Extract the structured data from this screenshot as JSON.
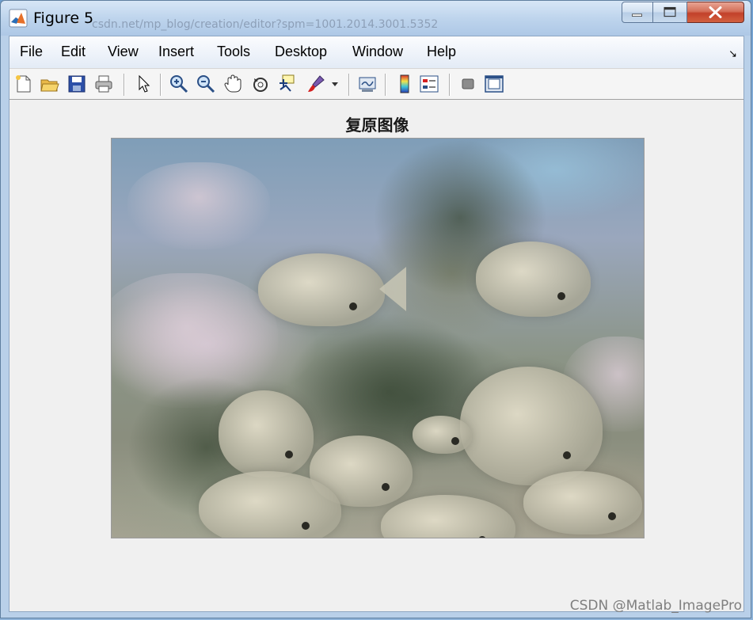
{
  "window": {
    "title": "Figure 5",
    "background_url_fragment": "csdn.net/mp_blog/creation/editor?spm=1001.2014.3001.5352"
  },
  "menu": {
    "items": [
      {
        "label": "File"
      },
      {
        "label": "Edit"
      },
      {
        "label": "View"
      },
      {
        "label": "Insert"
      },
      {
        "label": "Tools"
      },
      {
        "label": "Desktop"
      },
      {
        "label": "Window"
      },
      {
        "label": "Help"
      }
    ],
    "dock_glyph": "↘"
  },
  "toolbar": {
    "buttons": [
      {
        "icon": "new-figure-icon"
      },
      {
        "icon": "open-file-icon"
      },
      {
        "icon": "save-icon"
      },
      {
        "icon": "print-icon"
      },
      {
        "icon": "edit-plot-arrow-icon"
      },
      {
        "icon": "zoom-in-icon"
      },
      {
        "icon": "zoom-out-icon"
      },
      {
        "icon": "pan-hand-icon"
      },
      {
        "icon": "rotate-3d-icon"
      },
      {
        "icon": "data-cursor-icon"
      },
      {
        "icon": "brush-icon"
      },
      {
        "icon": "link-plot-icon"
      },
      {
        "icon": "colorbar-icon"
      },
      {
        "icon": "legend-icon"
      },
      {
        "icon": "hide-plot-tools-icon"
      },
      {
        "icon": "show-plot-tools-icon"
      }
    ]
  },
  "figure": {
    "axes_title": "复原图像"
  },
  "watermark": "CSDN @Matlab_ImagePro",
  "colors": {
    "client_bg": "#f0f0f0",
    "titlebar": "#bcd3ec",
    "close_button": "#c2412a"
  }
}
